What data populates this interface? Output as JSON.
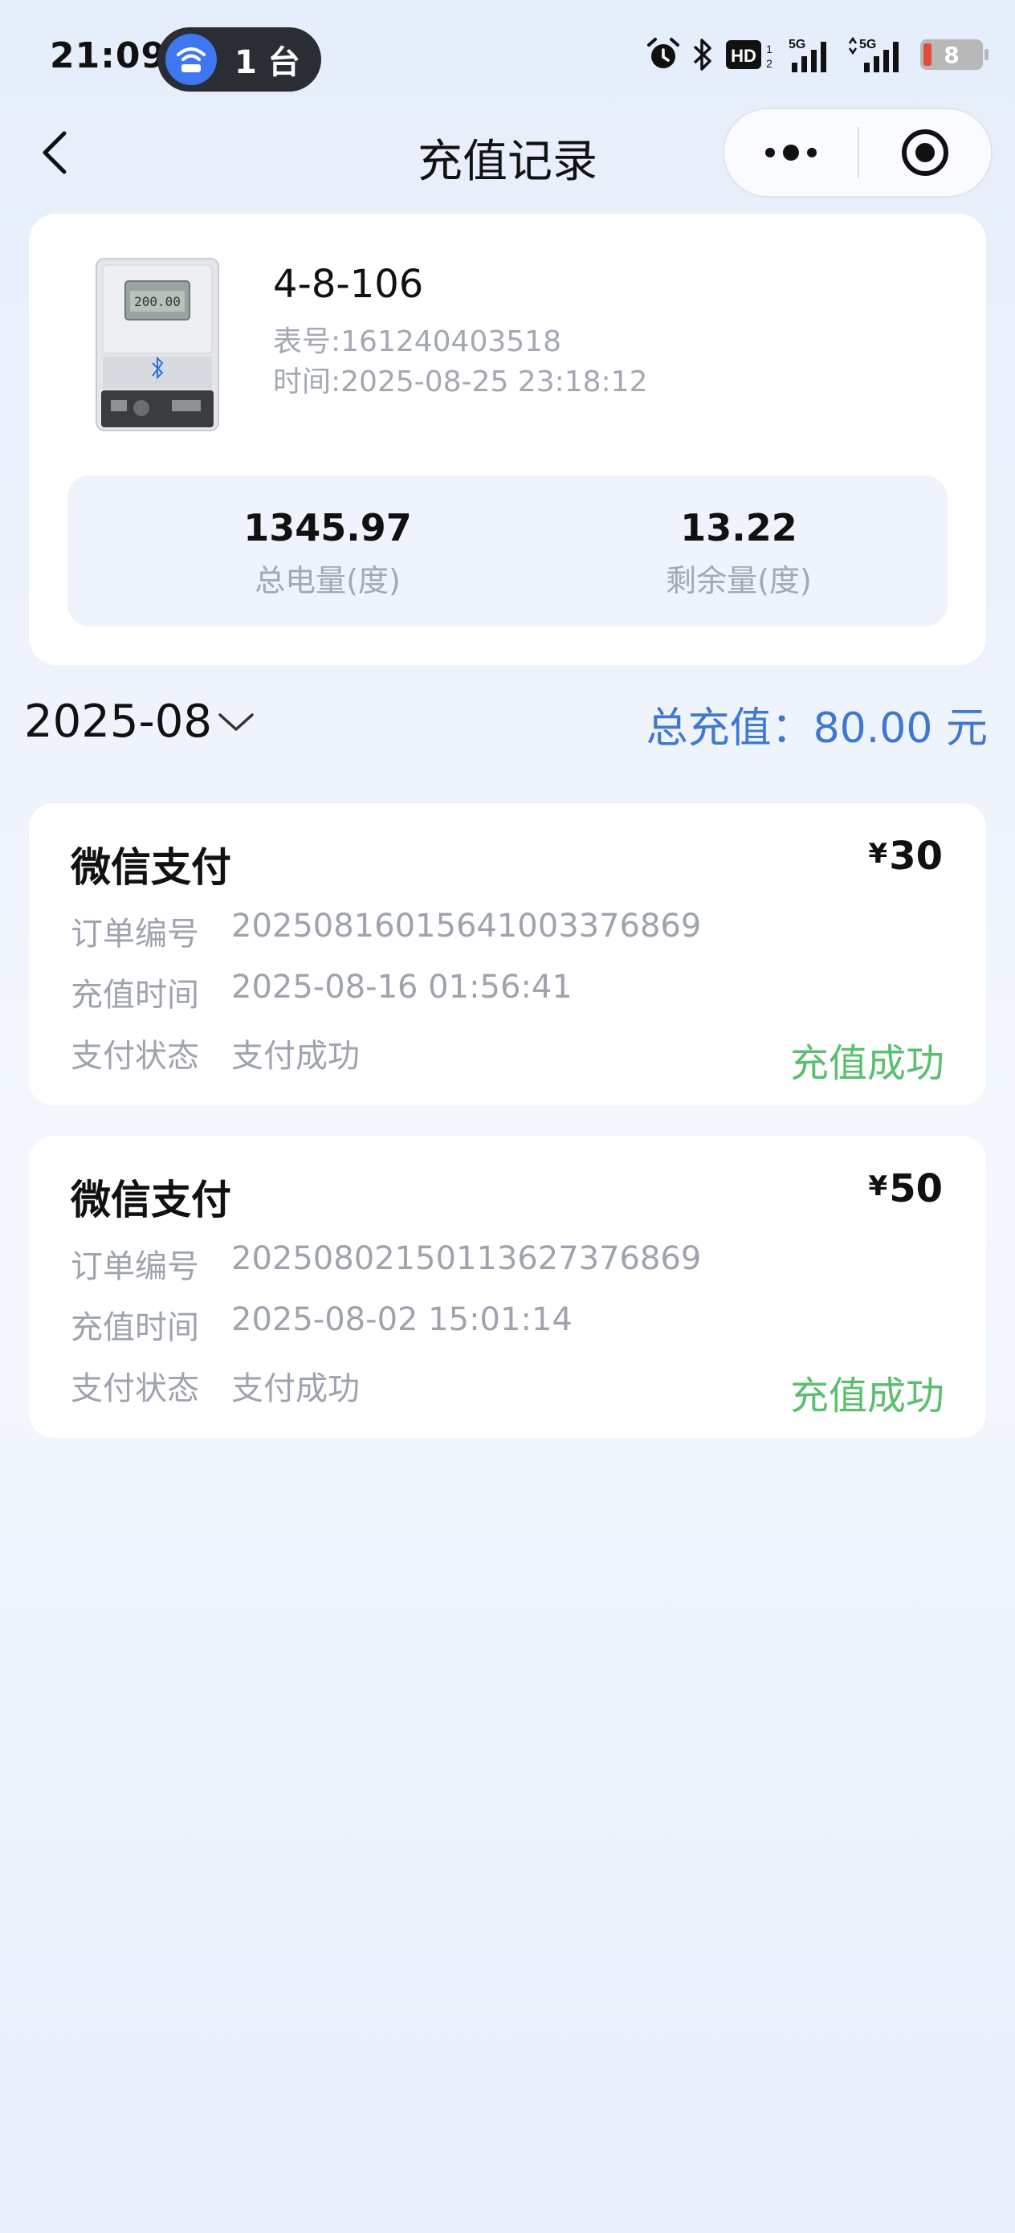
{
  "status_bar": {
    "time": "21:09",
    "hotspot_count": "1 台",
    "battery_level": "8",
    "icons": [
      "hotspot-icon",
      "alarm-icon",
      "bluetooth-icon",
      "hd-icon",
      "signal-5g-icon",
      "signal-5g-icon",
      "battery-icon"
    ]
  },
  "nav": {
    "title": "充值记录",
    "back_icon": "chevron-left-icon",
    "more_icon": "more-dots-icon",
    "close_icon": "target-close-icon"
  },
  "meter": {
    "name": "4-8-106",
    "number": "表号:161240403518",
    "time": "时间:2025-08-25 23:18:12",
    "display_reading": "200.00",
    "stats": [
      {
        "value": "1345.97",
        "label": "总电量(度)"
      },
      {
        "value": "13.22",
        "label": "剩余量(度)"
      }
    ]
  },
  "filter": {
    "month": "2025-08",
    "total": "总充值：80.00 元"
  },
  "records": [
    {
      "method": "微信支付",
      "currency": "¥",
      "amount": "30",
      "order_label": "订单编号",
      "order_no": "20250816015641003376869",
      "time_label": "充值时间",
      "time": "2025-08-16 01:56:41",
      "pay_status_label": "支付状态",
      "pay_status": "支付成功",
      "recharge_status": "充值成功"
    },
    {
      "method": "微信支付",
      "currency": "¥",
      "amount": "50",
      "order_label": "订单编号",
      "order_no": "20250802150113627376869",
      "time_label": "充值时间",
      "time": "2025-08-02 15:01:14",
      "pay_status_label": "支付状态",
      "pay_status": "支付成功",
      "recharge_status": "充值成功"
    }
  ],
  "colors": {
    "accent_blue": "#3f78cf",
    "success_green": "#5bbf6f",
    "muted_text": "#a3a8b2",
    "stats_bg": "#eef3fc"
  }
}
